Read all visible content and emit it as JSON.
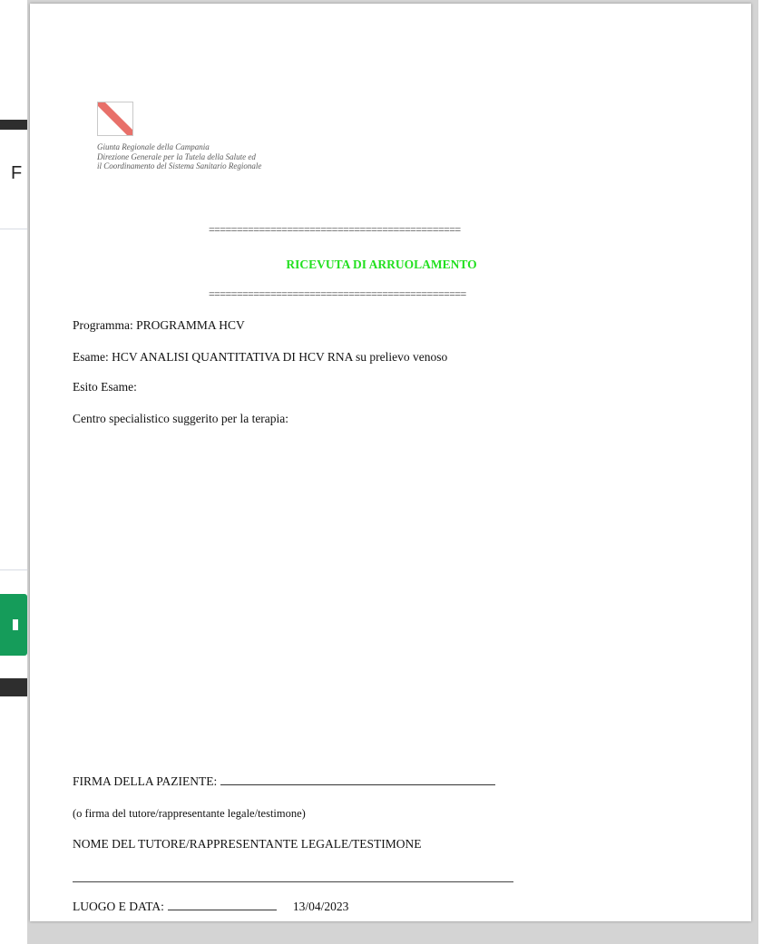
{
  "document": {
    "agency_lines": [
      "Giunta Regionale della Campania",
      "Direzione Generale per la Tutela della Salute ed",
      "il Coordinamento del Sistema Sanitario Regionale"
    ],
    "rule_top": "=============================================",
    "rule_bottom": "==============================================",
    "title": "RICEVUTA DI ARRUOLAMENTO",
    "programma": "Programma: PROGRAMMA HCV",
    "esame": "Esame: HCV ANALISI QUANTITATIVA DI HCV RNA su prelievo venoso",
    "esito": "Esito Esame:",
    "centro": "Centro specialistico suggerito per la terapia:",
    "firma_label": "FIRMA DELLA PAZIENTE:",
    "firma_alt": "(o firma del tutore/rappresentante legale/testimone)",
    "nome_tutore": "NOME DEL TUTORE/RAPPRESENTANTE LEGALE/TESTIMONE",
    "luogo_label": "LUOGO E DATA:",
    "date": "13/04/2023"
  },
  "colors": {
    "title_green": "#22e01f",
    "logo_red": "#e8706a",
    "side_green": "#159c5a"
  },
  "icons": {
    "logo": "campania-region-logo"
  }
}
